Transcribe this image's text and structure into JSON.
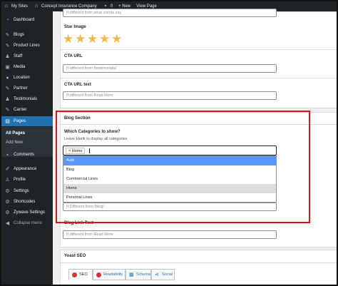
{
  "adminbar": {
    "site": "My Sites",
    "company": "Concept Insurance Company",
    "comments": "0",
    "new": "+ New",
    "view": "View Page"
  },
  "sidebar": {
    "items": [
      {
        "label": "Dashboard",
        "icon": "dashboard-icon"
      },
      {
        "label": "Blogs",
        "icon": "pushpin-icon"
      },
      {
        "label": "Product Lines",
        "icon": "pushpin-icon"
      },
      {
        "label": "Staff",
        "icon": "users-icon"
      },
      {
        "label": "Media",
        "icon": "media-icon"
      },
      {
        "label": "Location",
        "icon": "location-icon"
      },
      {
        "label": "Partner",
        "icon": "pushpin-icon"
      },
      {
        "label": "Testimonials",
        "icon": "users-icon"
      },
      {
        "label": "Carrier",
        "icon": "pushpin-icon"
      },
      {
        "label": "Pages",
        "icon": "pages-icon"
      }
    ],
    "submenu": {
      "all_pages": "All Pages",
      "add_new": "Add New"
    },
    "items2": [
      {
        "label": "Comments",
        "icon": "comment-icon"
      },
      {
        "label": "Appearance",
        "icon": "brush-icon"
      },
      {
        "label": "Profile",
        "icon": "user-icon"
      },
      {
        "label": "Settings",
        "icon": "settings-icon"
      },
      {
        "label": "Shortcodes",
        "icon": "gear-icon"
      },
      {
        "label": "Zywave Settings",
        "icon": "gear-icon"
      }
    ],
    "collapse": "Collapse menu"
  },
  "main": {
    "top_placeholder": "If different from what clients say",
    "star_image_label": "Star Image",
    "star_count": 5,
    "cta_url_label": "CTA URL",
    "cta_url_placeholder": "If different from /testimonials/",
    "cta_text_label": "CTA URL text",
    "cta_text_placeholder": "If different from Read More",
    "blog_section": "Blog Section",
    "which_categories": "Which Categories to show?",
    "categories_hint": "Leave blank to display all categories",
    "selected_chip": "× Home",
    "dropdown_options": [
      "Auto",
      "Blog",
      "Commercial Lines",
      "Home",
      "Personal Lines"
    ],
    "blog_url_placeholder": "If Different from /blog/",
    "blog_link_text_label": "Blog Link Text",
    "blog_link_placeholder": "If different from Read More",
    "yoast_title": "Yoast SEO",
    "tabs": [
      "SEO",
      "Readability",
      "Schema",
      "Social"
    ]
  },
  "colors": {
    "accent": "#2271b1",
    "highlight": "#5897fb",
    "outline": "#e0131a",
    "star": "#f0b849"
  }
}
